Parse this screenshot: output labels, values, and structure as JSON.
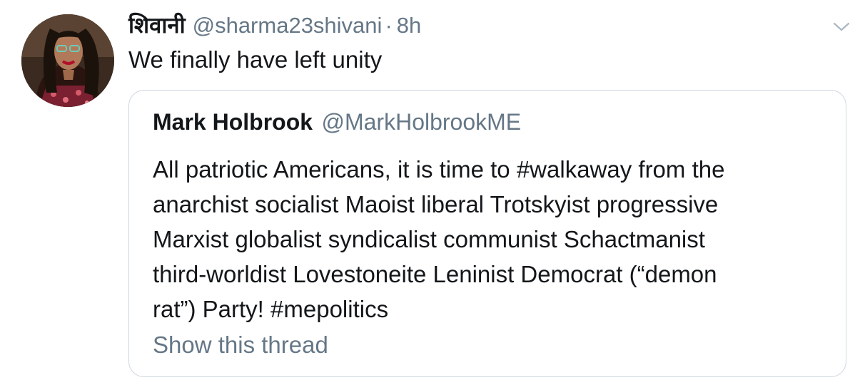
{
  "tweet": {
    "display_name": "शिवानी",
    "handle": "@sharma23shivani",
    "separator": "·",
    "timestamp": "8h",
    "text": "We finally have left unity",
    "menu_icon": "chevron-down-icon"
  },
  "quoted_tweet": {
    "name": "Mark Holbrook",
    "handle": "@MarkHolbrookME",
    "text_lines": [
      "All patriotic Americans, it is time to #walkaway from the",
      "anarchist socialist Maoist liberal Trotskyist progressive",
      "Marxist globalist syndicalist communist Schactmanist",
      "third-worldist Lovestoneite Leninist Democrat (“demon",
      "rat”) Party! #mepolitics"
    ],
    "show_thread_label": "Show this thread"
  },
  "colors": {
    "text_primary": "#14171a",
    "text_secondary": "#657786",
    "border": "#ccd6dd",
    "background": "#ffffff"
  }
}
